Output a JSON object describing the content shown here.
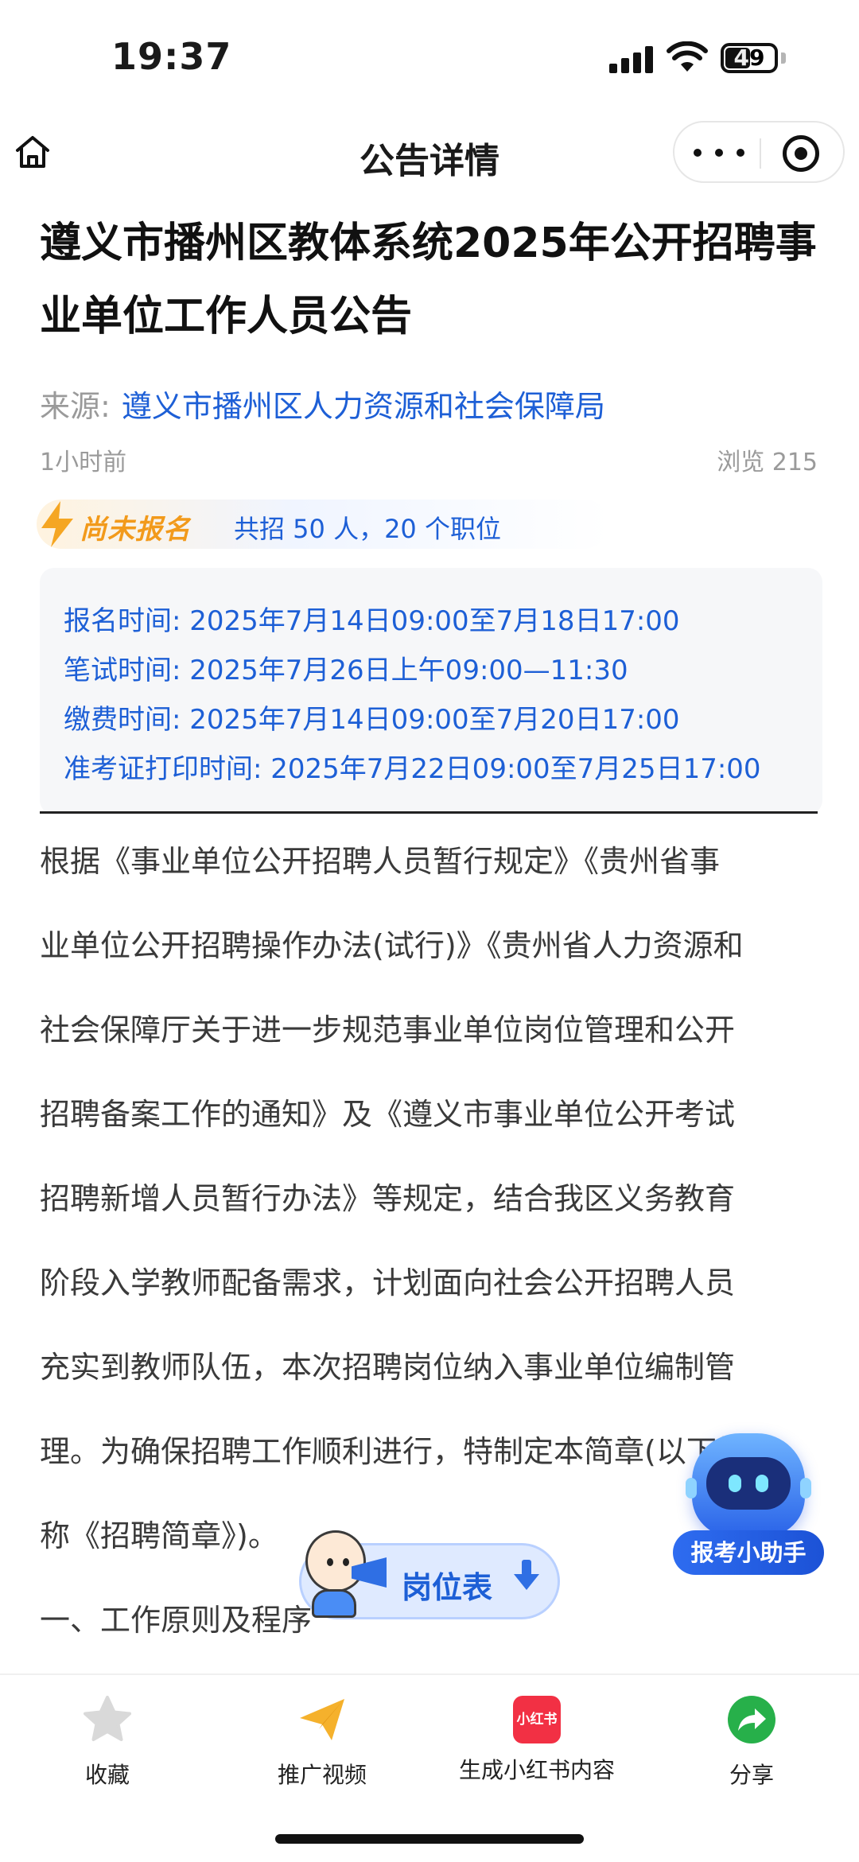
{
  "status_bar": {
    "time": "19:37",
    "battery": "49"
  },
  "nav": {
    "title": "公告详情",
    "home_icon": "home-icon",
    "more_icon": "more-dots-icon",
    "close_icon": "target-close-icon"
  },
  "article": {
    "title": "遵义市播州区教体系统2025年公开招聘事业单位工作人员公告",
    "source_label": "来源:",
    "source_value": "遵义市播州区人力资源和社会保障局",
    "time_ago": "1小时前",
    "views": "浏览 215",
    "status_badge": "尚未报名",
    "summary": "共招 50 人，20 个职位",
    "schedule": [
      "报名时间: 2025年7月14日09:00至7月18日17:00",
      "笔试时间: 2025年7月26日上午09:00—11:30",
      "缴费时间: 2025年7月14日09:00至7月20日17:00",
      "准考证打印时间: 2025年7月22日09:00至7月25日17:00"
    ],
    "body_lines": [
      "根据《事业单位公开招聘人员暂行规定》《贵州省事",
      "业单位公开招聘操作办法(试行)》《贵州省人力资源和",
      "社会保障厅关于进一步规范事业单位岗位管理和公开",
      "招聘备案工作的通知》及《遵义市事业单位公开考试",
      "招聘新增人员暂行办法》等规定，结合我区义务教育",
      "阶段入学教师配备需求，计划面向社会公开招聘人员",
      "充实到教师队伍，本次招聘岗位纳入事业单位编制管",
      "理。为确保招聘工作顺利进行，特制定本简章(以下简",
      "称《招聘简章》)。",
      "一、工作原则及程序"
    ]
  },
  "floating": {
    "assistant_label": "报考小助手",
    "job_table_label": "岗位表"
  },
  "bottom_bar": {
    "tabs": [
      {
        "label": "收藏",
        "icon": "star-icon"
      },
      {
        "label": "推广视频",
        "icon": "paper-plane-icon"
      },
      {
        "label": "生成小红书内容",
        "icon": "xiaohongshu-icon",
        "icon_text": "小红书"
      },
      {
        "label": "分享",
        "icon": "share-icon"
      }
    ]
  },
  "colors": {
    "link_blue": "#1d5fd6",
    "badge_orange": "#f29a1b",
    "muted_gray": "#9a9a9a"
  }
}
